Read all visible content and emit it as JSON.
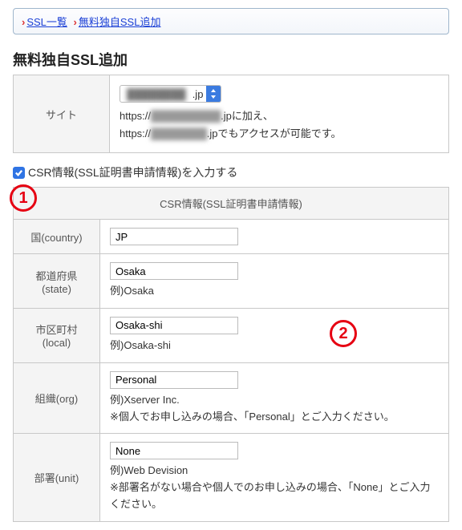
{
  "breadcrumb": {
    "link1": "SSL一覧",
    "link2": "無料独自SSL追加"
  },
  "page_title": "無料独自SSL追加",
  "site_row": {
    "label": "サイト",
    "tld": ".jp",
    "desc_prefix1": "https://",
    "desc_suffix1": ".jpに加え、",
    "desc_prefix2": "https://",
    "desc_suffix2": ".jpでもアクセスが可能です。"
  },
  "annotations": {
    "one": "1",
    "two": "2"
  },
  "csr_check": {
    "label": "CSR情報(SSL証明書申請情報)を入力する"
  },
  "csr_section_title": "CSR情報(SSL証明書申請情報)",
  "csr": {
    "country": {
      "label": "国(country)",
      "value": "JP"
    },
    "state": {
      "label": "都道府県\n(state)",
      "value": "Osaka",
      "hint": "例)Osaka"
    },
    "local": {
      "label": "市区町村\n(local)",
      "value": "Osaka-shi",
      "hint": "例)Osaka-shi"
    },
    "org": {
      "label": "組織(org)",
      "value": "Personal",
      "hint": "例)Xserver Inc.\n※個人でお申し込みの場合、「Personal」とご入力ください。"
    },
    "unit": {
      "label": "部署(unit)",
      "value": "None",
      "hint": "例)Web Devision\n※部署名がない場合や個人でのお申し込みの場合、「None」とご入力ください。"
    }
  }
}
